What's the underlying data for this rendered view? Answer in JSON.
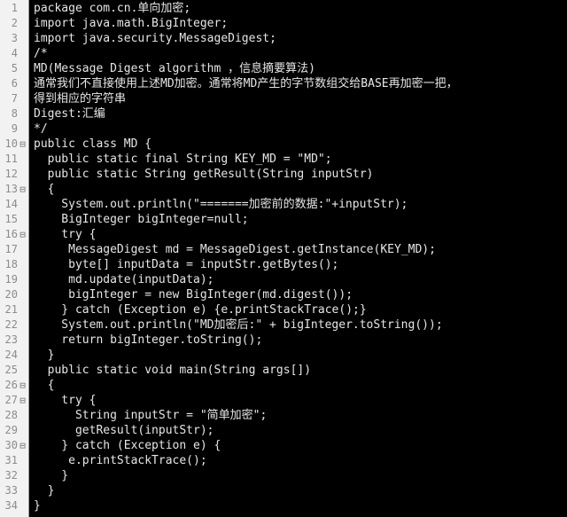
{
  "editor": {
    "language": "java",
    "first_line_number": 1,
    "total_lines": 34,
    "gutter_bg": "#f2f2f2",
    "code_bg": "#000000",
    "code_fg": "#e6e6e6",
    "lineno_fg": "#8c8c8c",
    "fold_glyph": "⊟"
  },
  "lines": [
    {
      "n": "1",
      "fold": false,
      "text": "package com.cn.单向加密;"
    },
    {
      "n": "2",
      "fold": false,
      "text": "import java.math.BigInteger;"
    },
    {
      "n": "3",
      "fold": false,
      "text": "import java.security.MessageDigest;"
    },
    {
      "n": "4",
      "fold": false,
      "text": "/*"
    },
    {
      "n": "5",
      "fold": false,
      "text": "MD(Message Digest algorithm ，信息摘要算法)"
    },
    {
      "n": "6",
      "fold": false,
      "text": "通常我们不直接使用上述MD加密。通常将MD产生的字节数组交给BASE再加密一把，"
    },
    {
      "n": "7",
      "fold": false,
      "text": "得到相应的字符串"
    },
    {
      "n": "8",
      "fold": false,
      "text": "Digest:汇编"
    },
    {
      "n": "9",
      "fold": false,
      "text": "*/"
    },
    {
      "n": "10",
      "fold": true,
      "text": "public class MD {"
    },
    {
      "n": "11",
      "fold": false,
      "text": "  public static final String KEY_MD = \"MD\";"
    },
    {
      "n": "12",
      "fold": false,
      "text": "  public static String getResult(String inputStr)"
    },
    {
      "n": "13",
      "fold": true,
      "text": "  {"
    },
    {
      "n": "14",
      "fold": false,
      "text": "    System.out.println(\"=======加密前的数据:\"+inputStr);"
    },
    {
      "n": "15",
      "fold": false,
      "text": "    BigInteger bigInteger=null;"
    },
    {
      "n": "16",
      "fold": true,
      "text": "    try {"
    },
    {
      "n": "17",
      "fold": false,
      "text": "     MessageDigest md = MessageDigest.getInstance(KEY_MD);"
    },
    {
      "n": "18",
      "fold": false,
      "text": "     byte[] inputData = inputStr.getBytes();"
    },
    {
      "n": "19",
      "fold": false,
      "text": "     md.update(inputData);"
    },
    {
      "n": "20",
      "fold": false,
      "text": "     bigInteger = new BigInteger(md.digest());"
    },
    {
      "n": "21",
      "fold": false,
      "text": "    } catch (Exception e) {e.printStackTrace();}"
    },
    {
      "n": "22",
      "fold": false,
      "text": "    System.out.println(\"MD加密后:\" + bigInteger.toString());"
    },
    {
      "n": "23",
      "fold": false,
      "text": "    return bigInteger.toString();"
    },
    {
      "n": "24",
      "fold": false,
      "text": "  }"
    },
    {
      "n": "25",
      "fold": false,
      "text": "  public static void main(String args[])"
    },
    {
      "n": "26",
      "fold": true,
      "text": "  {"
    },
    {
      "n": "27",
      "fold": true,
      "text": "    try {"
    },
    {
      "n": "28",
      "fold": false,
      "text": "      String inputStr = \"简单加密\";"
    },
    {
      "n": "29",
      "fold": false,
      "text": "      getResult(inputStr);"
    },
    {
      "n": "30",
      "fold": true,
      "text": "    } catch (Exception e) {"
    },
    {
      "n": "31",
      "fold": false,
      "text": "     e.printStackTrace();"
    },
    {
      "n": "32",
      "fold": false,
      "text": "    }"
    },
    {
      "n": "33",
      "fold": false,
      "text": "  }"
    },
    {
      "n": "34",
      "fold": false,
      "text": "}"
    }
  ]
}
